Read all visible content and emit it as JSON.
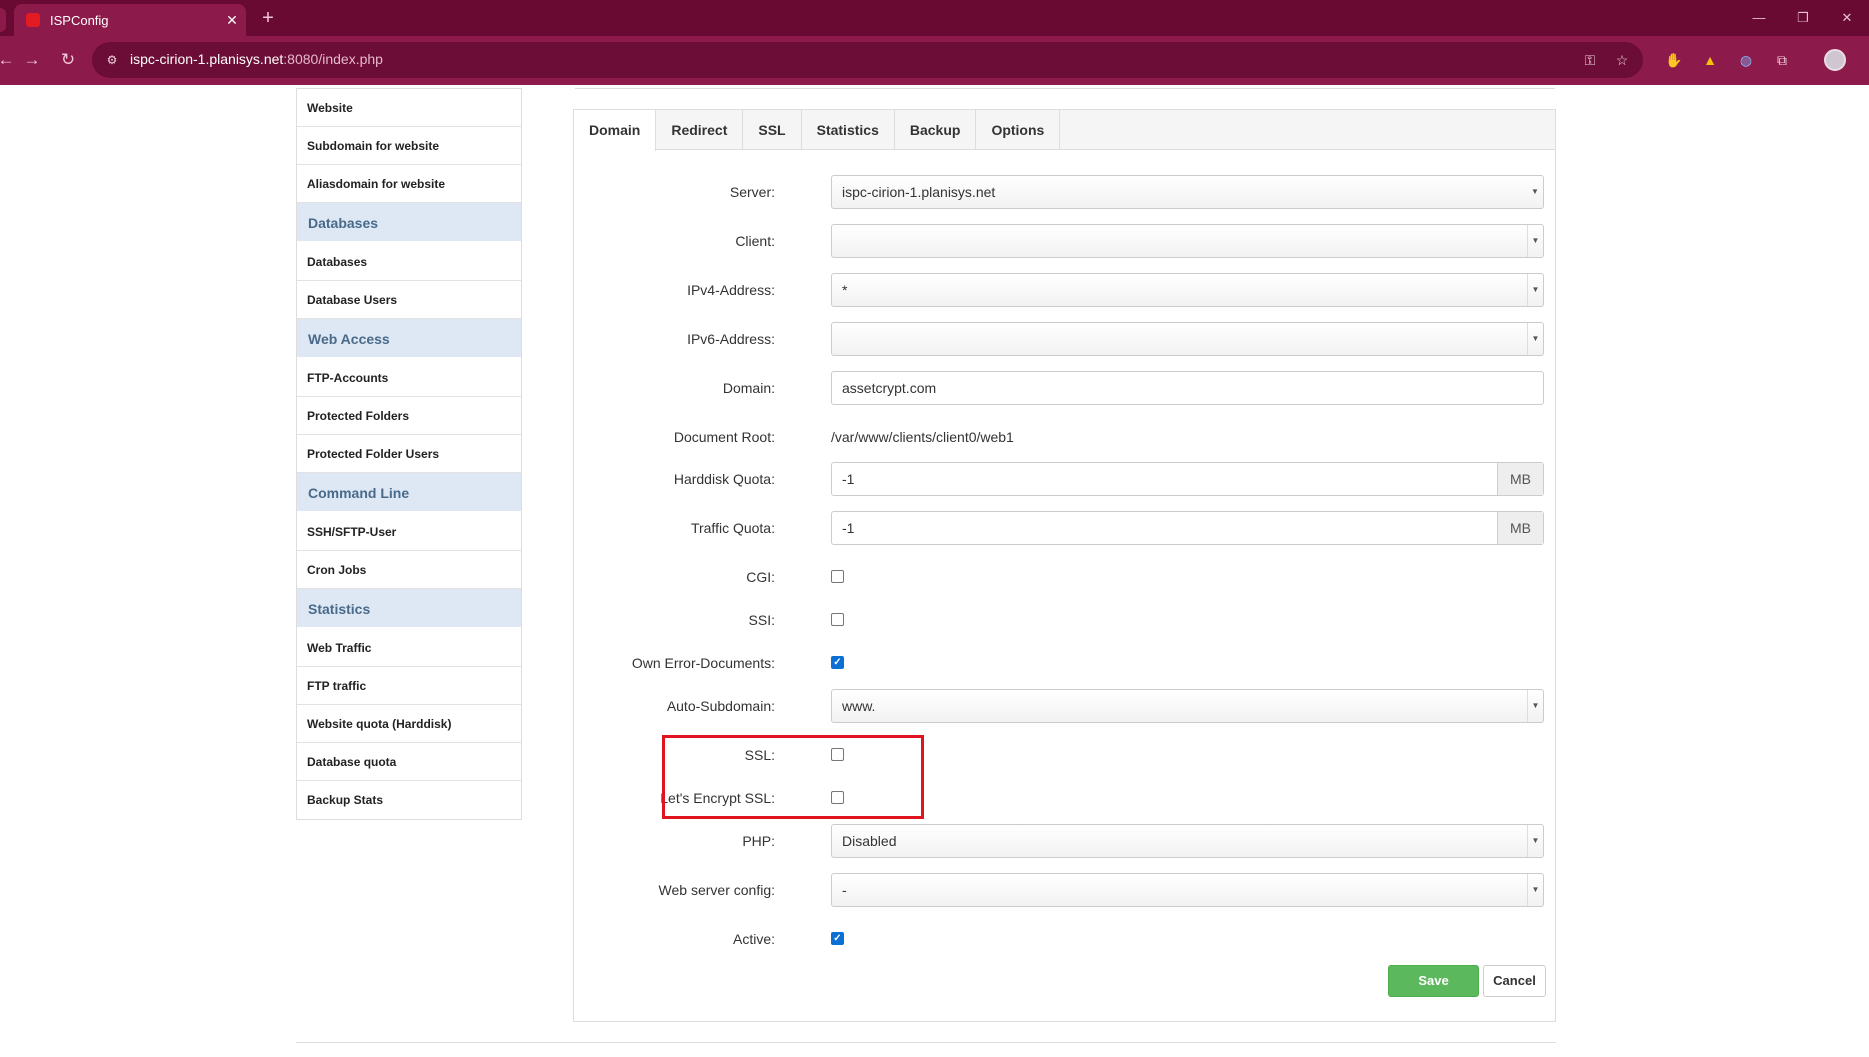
{
  "browser": {
    "tab_title": "ISPConfig",
    "tab_close": "✕",
    "new_tab": "+",
    "url_host": "ispc-cirion-1.planisys.net",
    "url_rest": ":8080/index.php",
    "window_controls": [
      "—",
      "❐",
      "✕"
    ]
  },
  "sidebar": {
    "items": [
      {
        "type": "item",
        "label": "Website"
      },
      {
        "type": "item",
        "label": "Subdomain for website"
      },
      {
        "type": "item",
        "label": "Aliasdomain for website"
      },
      {
        "type": "section",
        "label": "Databases"
      },
      {
        "type": "item",
        "label": "Databases"
      },
      {
        "type": "item",
        "label": "Database Users"
      },
      {
        "type": "section",
        "label": "Web Access"
      },
      {
        "type": "item",
        "label": "FTP-Accounts"
      },
      {
        "type": "item",
        "label": "Protected Folders"
      },
      {
        "type": "item",
        "label": "Protected Folder Users"
      },
      {
        "type": "section",
        "label": "Command Line"
      },
      {
        "type": "item",
        "label": "SSH/SFTP-User"
      },
      {
        "type": "item",
        "label": "Cron Jobs"
      },
      {
        "type": "section",
        "label": "Statistics"
      },
      {
        "type": "item",
        "label": "Web Traffic"
      },
      {
        "type": "item",
        "label": "FTP traffic"
      },
      {
        "type": "item",
        "label": "Website quota (Harddisk)"
      },
      {
        "type": "item",
        "label": "Database quota"
      },
      {
        "type": "item",
        "label": "Backup Stats"
      }
    ]
  },
  "tabs": [
    {
      "label": "Domain",
      "active": true
    },
    {
      "label": "Redirect",
      "active": false
    },
    {
      "label": "SSL",
      "active": false
    },
    {
      "label": "Statistics",
      "active": false
    },
    {
      "label": "Backup",
      "active": false
    },
    {
      "label": "Options",
      "active": false
    }
  ],
  "form": {
    "server": {
      "label": "Server:",
      "value": "ispc-cirion-1.planisys.net"
    },
    "client": {
      "label": "Client:",
      "value": ""
    },
    "ipv4": {
      "label": "IPv4-Address:",
      "value": "*"
    },
    "ipv6": {
      "label": "IPv6-Address:",
      "value": ""
    },
    "domain": {
      "label": "Domain:",
      "value": "assetcrypt.com"
    },
    "document_root": {
      "label": "Document Root:",
      "value": "/var/www/clients/client0/web1"
    },
    "harddisk_quota": {
      "label": "Harddisk Quota:",
      "value": "-1",
      "unit": "MB"
    },
    "traffic_quota": {
      "label": "Traffic Quota:",
      "value": "-1",
      "unit": "MB"
    },
    "cgi": {
      "label": "CGI:",
      "checked": false
    },
    "ssi": {
      "label": "SSI:",
      "checked": false
    },
    "own_error_documents": {
      "label": "Own Error-Documents:",
      "checked": true
    },
    "auto_subdomain": {
      "label": "Auto-Subdomain:",
      "value": "www."
    },
    "ssl": {
      "label": "SSL:",
      "checked": false
    },
    "letsencrypt_ssl": {
      "label": "Let's Encrypt SSL:",
      "checked": false
    },
    "php": {
      "label": "PHP:",
      "value": "Disabled"
    },
    "web_server_config": {
      "label": "Web server config:",
      "value": "-"
    },
    "active": {
      "label": "Active:",
      "checked": true
    }
  },
  "buttons": {
    "save": "Save",
    "cancel": "Cancel"
  },
  "colors": {
    "browser_frame": "#690a33",
    "highlight_box": "#e0141e",
    "save_button": "#5cb85c",
    "sidebar_section": "#dde8f4"
  }
}
